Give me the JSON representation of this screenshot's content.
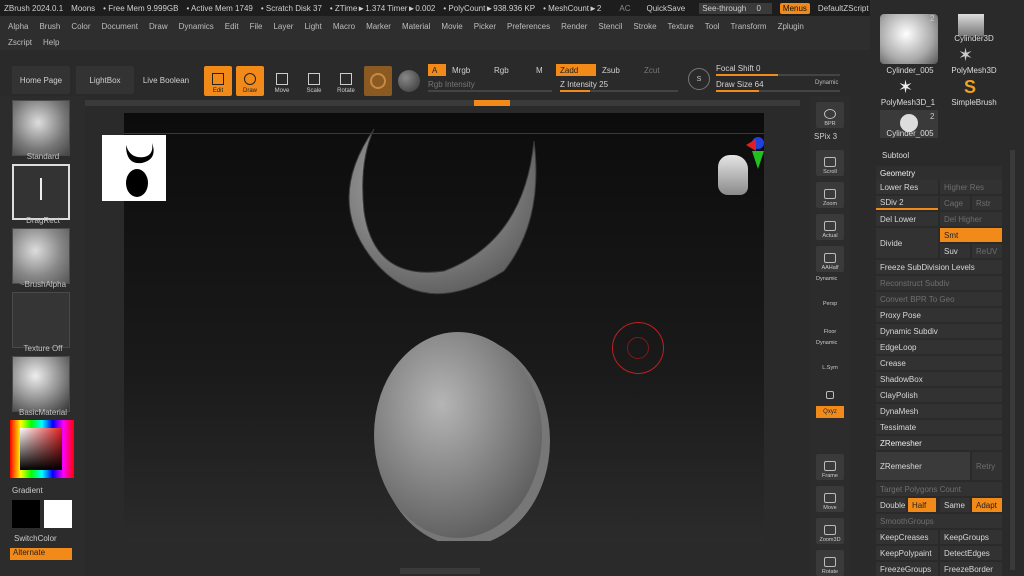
{
  "titlebar": {
    "app": "ZBrush 2024.0.1",
    "doc": "Moons",
    "free_mem": "• Free Mem 9.999GB",
    "active_mem": "• Active Mem 1749",
    "scratch": "• Scratch Disk 37",
    "ztime": "• ZTime►1.374 Timer►0.002",
    "polycount": "• PolyCount►938.936 KP",
    "meshcount": "• MeshCount►2",
    "ac": "AC",
    "quicksave": "QuickSave",
    "seethrough": "See-through",
    "seethrough_val": "0",
    "menus": "Menus",
    "defaultzscript": "DefaultZScript"
  },
  "menubar": {
    "row1": [
      "Alpha",
      "Brush",
      "Color",
      "Document",
      "Draw",
      "Dynamics",
      "Edit",
      "File",
      "Layer",
      "Light",
      "Macro",
      "Marker",
      "Material",
      "Movie",
      "Picker",
      "Preferences",
      "Render",
      "Stencil",
      "Stroke",
      "Texture",
      "Tool",
      "Transform",
      "Zplugin"
    ],
    "row2": [
      "Zscript",
      "Help"
    ]
  },
  "toolbar": {
    "home": "Home Page",
    "lightbox": "LightBox",
    "liveboolean": "Live Boolean",
    "edit": "Edit",
    "draw": "Draw",
    "move": "Move",
    "scale": "Scale",
    "rotate": "Rotate",
    "a": "A",
    "mrgb": "Mrgb",
    "rgb": "Rgb",
    "m": "M",
    "rgb_intensity": "Rgb Intensity",
    "zadd": "Zadd",
    "zsub": "Zsub",
    "zcut": "Zcut",
    "z_intensity": "Z Intensity 25",
    "focal_shift": "Focal Shift 0",
    "draw_size": "Draw Size 64",
    "dynamic": "Dynamic",
    "z_intensity_level": 0.25,
    "focal_shift_level": 0.5,
    "draw_size_level": 0.35
  },
  "leftshelf": {
    "standard": "Standard",
    "dragrect": "DragRect",
    "brushalpha": "~BrushAlpha",
    "textureoff": "Texture Off",
    "basicmaterial": "BasicMaterial",
    "gradient": "Gradient",
    "switchcolor": "SwitchColor",
    "alternate": "Alternate"
  },
  "rightstrip": {
    "bpr": "BPR",
    "spix": "SPix 3",
    "scroll": "Scroll",
    "zoom": "Zoom",
    "actual": "Actual",
    "aahalf": "AAHalf",
    "dynamic_persp": "Dynamic",
    "persp": "Persp",
    "floor": "Floor",
    "dynamic_lsym": "Dynamic",
    "lsym": "L.Sym",
    "xyz": "Qxyz",
    "frame": "Frame",
    "move": "Move",
    "zoom3d": "Zoom3D",
    "rotate": "Rotate"
  },
  "tools": {
    "cylinder_005_badge": "2",
    "cylinder3d": "Cylinder3D",
    "cylinder_005": "Cylinder_005",
    "polymesh3d": "PolyMesh3D",
    "polymesh3d_1": "PolyMesh3D_1",
    "simplebrush": "SimpleBrush",
    "cylinder_005b": "Cylinder_005",
    "cylinder_005b_badge": "2"
  },
  "subtool": {
    "subtool": "Subtool",
    "geometry": "Geometry",
    "lower_res": "Lower Res",
    "higher_res": "Higher Res",
    "sdiv": "SDiv 2",
    "cage": "Cage",
    "rstr": "Rstr",
    "del_lower": "Del Lower",
    "del_higher": "Del Higher",
    "divide": "Divide",
    "smt": "Smt",
    "suv": "Suv",
    "reuv": "ReUV",
    "freeze_subdiv": "Freeze SubDivision Levels",
    "reconstruct": "Reconstruct Subdiv",
    "convert_bpr": "Convert BPR To Geo",
    "proxy_pose": "Proxy Pose",
    "dynamic_subdiv": "Dynamic Subdiv",
    "edgeloop": "EdgeLoop",
    "crease": "Crease",
    "shadowbox": "ShadowBox",
    "claypolish": "ClayPolish",
    "dynamesh": "DynaMesh",
    "tessimate": "Tessimate",
    "zremesher_header": "ZRemesher",
    "zremesher": "ZRemesher",
    "retry": "Retry",
    "target_polygons": "Target Polygons Count",
    "double": "Double",
    "half": "Half",
    "same": "Same",
    "adapt": "Adapt",
    "smoothgroups": "SmoothGroups",
    "keepcreases": "KeepCreases",
    "keepgroups": "KeepGroups",
    "keeppolypaint": "KeepPolypaint",
    "detectedges": "DetectEdges",
    "freezegroups": "FreezeGroups",
    "freezeborder": "FreezeBorder"
  },
  "colors": {
    "accent": "#f28a1a",
    "bg": "#2a2a2a"
  }
}
